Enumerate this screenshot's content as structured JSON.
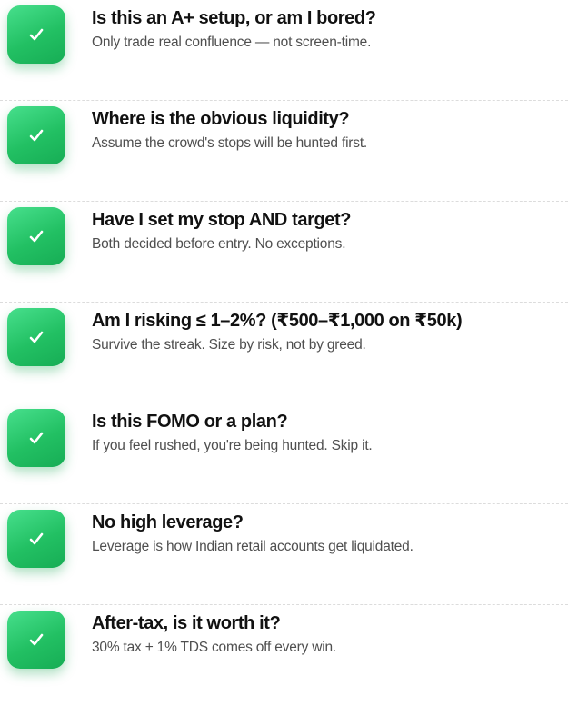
{
  "accent": "#22c063",
  "check_icon": "checkmark-icon",
  "items": [
    {
      "title": "Is this an A+ setup, or am I bored?",
      "subtitle": "Only trade real confluence — not screen-time."
    },
    {
      "title": "Where is the obvious liquidity?",
      "subtitle": "Assume the crowd's stops will be hunted first."
    },
    {
      "title": "Have I set my stop AND target?",
      "subtitle": "Both decided before entry. No exceptions."
    },
    {
      "title": "Am I risking ≤ 1–2%? (₹500–₹1,000 on ₹50k)",
      "subtitle": "Survive the streak. Size by risk, not by greed."
    },
    {
      "title": "Is this FOMO or a plan?",
      "subtitle": "If you feel rushed, you're being hunted. Skip it."
    },
    {
      "title": "No high leverage?",
      "subtitle": "Leverage is how Indian retail accounts get liquidated."
    },
    {
      "title": "After-tax, is it worth it?",
      "subtitle": "30% tax + 1% TDS comes off every win."
    }
  ]
}
